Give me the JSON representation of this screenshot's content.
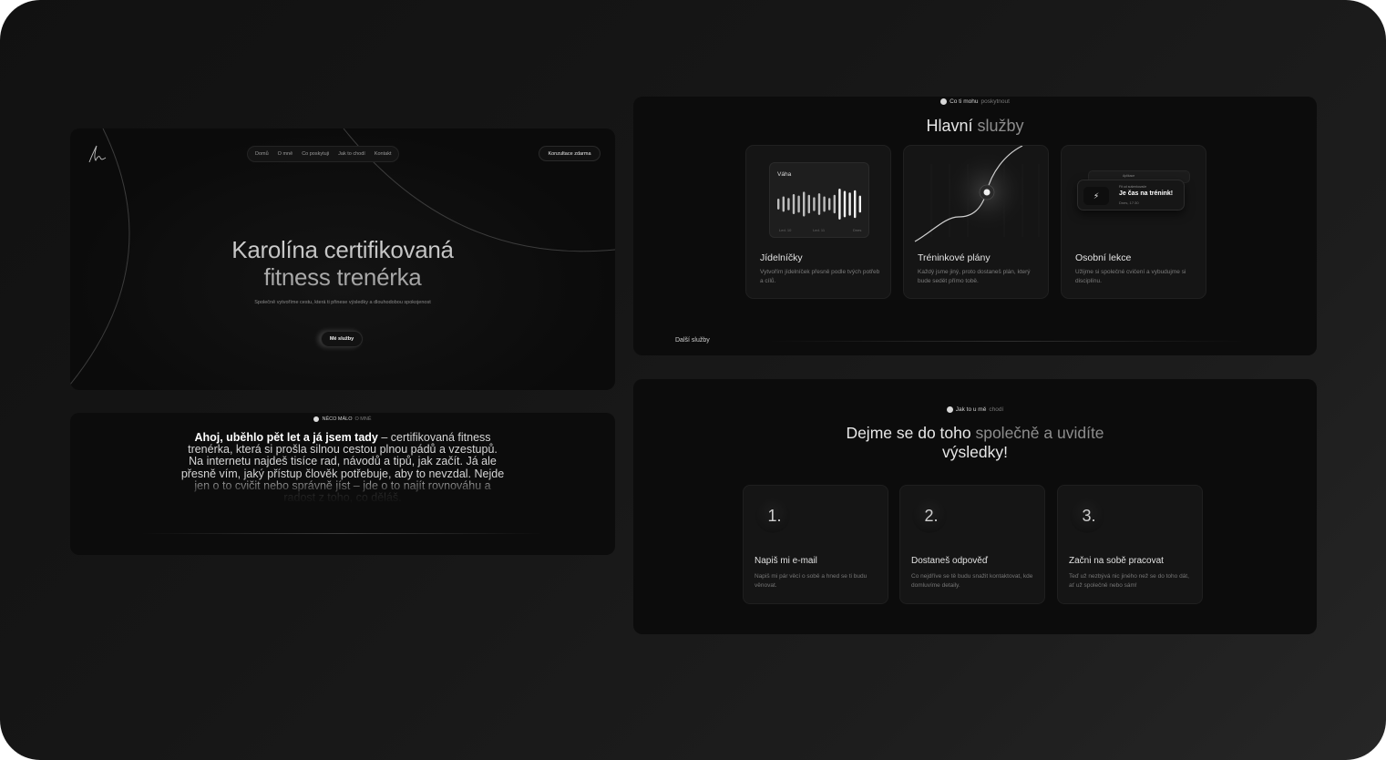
{
  "hero": {
    "nav": [
      "Domů",
      "O mně",
      "Co poskytuji",
      "Jak to chodí",
      "Kontakt"
    ],
    "cta_top": "Konzultace zdarma",
    "title_line1": "Karolína certifikovaná",
    "title_line2": "fitness trenérka",
    "subtitle": "Společně vytvoříme cestu, která ti přinese výsledky a dlouhodobou spokojenost",
    "button": "Mé služby"
  },
  "about": {
    "badge_main": "NĚCO MÁLO",
    "badge_muted": "O MNĚ",
    "intro_bold": "Ahoj, uběhlo pět let a já jsem tady",
    "intro_rest": " – certifikovaná fitness trenérka, která si prošla silnou cestou plnou pádů a vzestupů. Na internetu najdeš tisíce rad, návodů a tipů, jak začít. Já ale přesně vím, jaký přístup člověk potřebuje, aby to nevzdal. Nejde jen o to cvičit nebo správně jíst – jde o to najít rovnováhu a radost z toho, co děláš."
  },
  "services": {
    "badge_main": "Co ti mohu",
    "badge_muted": "poskytnout",
    "title_main": "Hlavní",
    "title_muted": " služby",
    "cards": [
      {
        "title": "Jídelníčky",
        "desc": "Vytvořím jídelníček přesně podle tvých potřeb a cílů."
      },
      {
        "title": "Tréninkové plány",
        "desc": "Každý jsme jiný, proto dostaneš plán, který bude sedět přímo tobě."
      },
      {
        "title": "Osobní lekce",
        "desc": "Užijme si společné cvičení a vybudujme si disciplínu."
      }
    ],
    "weight_label": "Váha",
    "weight_axis": [
      "Led. 10",
      "Led. 11",
      "Dnes"
    ],
    "notif_back": "Aplikace",
    "notif_small": "Fit od sušenkovače",
    "notif_big": "Je čas na trénink!",
    "notif_time": "Dnes, 17:30",
    "more": "Další služby",
    "chart_bars": [
      0.35,
      0.5,
      0.4,
      0.65,
      0.55,
      0.8,
      0.6,
      0.45,
      0.7,
      0.5,
      0.4,
      0.6,
      1.0,
      0.85,
      0.75,
      0.9,
      0.55
    ]
  },
  "steps": {
    "badge_main": "Jak to u mě",
    "badge_muted": "chodí",
    "title_line1_main": "Dejme se do toho",
    "title_line1_muted": " společně a uvidíte",
    "title_line2": "výsledky!",
    "items": [
      {
        "num": "1.",
        "title": "Napiš mi e-mail",
        "desc": "Napiš mi pár věcí o sobě a hned se ti budu věnovat."
      },
      {
        "num": "2.",
        "title": "Dostaneš odpověď",
        "desc": "Co nejdříve se tě budu snažit kontaktovat, kde domluvíme detaily."
      },
      {
        "num": "3.",
        "title": "Začni na sobě pracovat",
        "desc": "Teď už nezbývá nic jiného než se do toho dát, ať už společně nebo sám!"
      }
    ]
  }
}
